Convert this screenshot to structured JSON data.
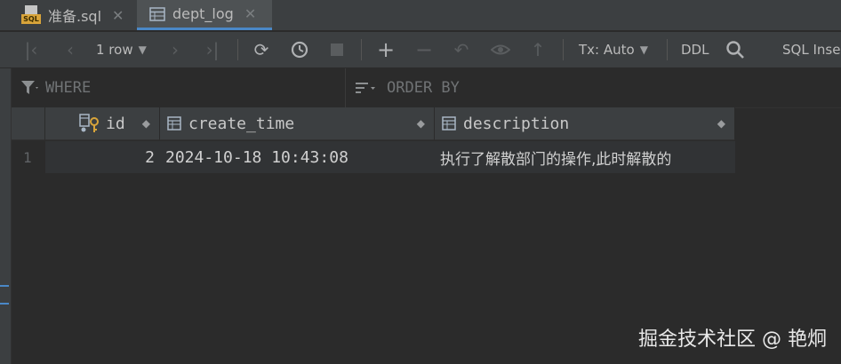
{
  "tabs": [
    {
      "label": "准备.sql",
      "icon": "sql-file-icon",
      "active": false
    },
    {
      "label": "dept_log",
      "icon": "table-icon",
      "active": true
    }
  ],
  "toolbar": {
    "row_count": "1 row",
    "tx_mode": "Tx: Auto",
    "ddl_label": "DDL",
    "sql_insert_label": "SQL Insert"
  },
  "filters": {
    "where_label": "WHERE",
    "order_by_label": "ORDER BY"
  },
  "table": {
    "columns": [
      {
        "name": "id",
        "icon": "primary-key-column-icon"
      },
      {
        "name": "create_time",
        "icon": "column-icon"
      },
      {
        "name": "description",
        "icon": "column-icon"
      }
    ],
    "rows": [
      {
        "num": "1",
        "id": "2",
        "create_time": "2024-10-18 10:43:08",
        "description": "执行了解散部门的操作,此时解散的"
      }
    ]
  },
  "watermark": "掘金技术社区 @ 艳炯",
  "colors": {
    "background": "#2b2b2b",
    "chrome": "#3c3f41",
    "active_tab_underline": "#4a88c7",
    "sql_badge": "#d8a43a",
    "key_icon": "#d8a43a",
    "text": "#d0d0d0"
  }
}
